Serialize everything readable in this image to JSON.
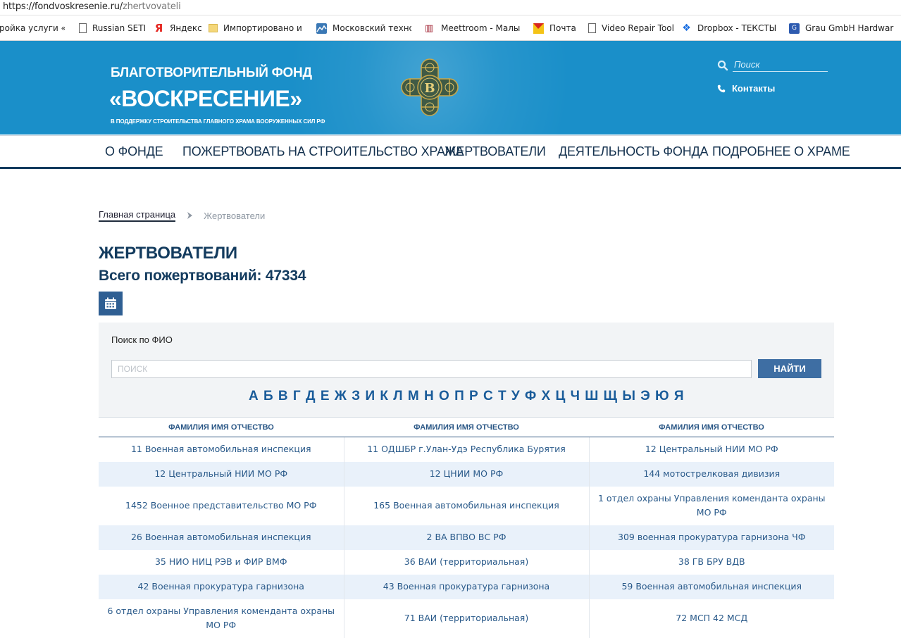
{
  "browser": {
    "url_host": "https://fondvoskresenie.ru/",
    "url_path": "zhertvovateli",
    "bookmarks": [
      {
        "label": "тройка услуги «С",
        "icon": "page-icon"
      },
      {
        "label": "Russian SETI",
        "icon": "page-icon"
      },
      {
        "label": "Яндекс",
        "icon": "yandex-icon"
      },
      {
        "label": "Импортировано из I",
        "icon": "folder-icon"
      },
      {
        "label": "Московский техноло",
        "icon": "mt-icon"
      },
      {
        "label": "Meettroom - Малый",
        "icon": "meettroom-icon"
      },
      {
        "label": "Почта",
        "icon": "mail-icon"
      },
      {
        "label": "Video Repair Tool",
        "icon": "page-icon"
      },
      {
        "label": "Dropbox - ТЕКСТЫ К",
        "icon": "dropbox-icon"
      },
      {
        "label": "Grau GmbH Hardwar",
        "icon": "grau-icon"
      }
    ]
  },
  "header": {
    "brand_line1": "БЛАГОТВОРИТЕЛЬНЫЙ ФОНД",
    "brand_line2": "«ВОСКРЕСЕНИЕ»",
    "brand_line3": "В ПОДДЕРЖКУ СТРОИТЕЛЬСТВА ГЛАВНОГО ХРАМА ВООРУЖЕННЫХ СИЛ РФ",
    "search_placeholder": "Поиск",
    "contacts_label": "Контакты",
    "colors": {
      "header_bg": "#1a8fc9",
      "nav_text": "#14314e",
      "title": "#133b5e",
      "accent": "#3e6ea3"
    }
  },
  "nav": [
    "О ФОНДЕ",
    "ПОЖЕРТВОВАТЬ НА СТРОИТЕЛЬСТВО ХРАМА",
    "ЖЕРТВОВАТЕЛИ",
    "ДЕЯТЕЛЬНОСТЬ ФОНДА",
    "ПОДРОБНЕЕ О ХРАМЕ"
  ],
  "breadcrumb": {
    "home": "Главная страница",
    "current": "Жертвователи"
  },
  "page": {
    "title": "ЖЕРТВОВАТЕЛИ",
    "total_label": "Всего пожертвований: 47334"
  },
  "search": {
    "label": "Поиск по ФИО",
    "placeholder": "ПОИСК",
    "button": "НАЙТИ"
  },
  "alphabet": [
    "А",
    "Б",
    "В",
    "Г",
    "Д",
    "Е",
    "Ж",
    "З",
    "И",
    "К",
    "Л",
    "М",
    "Н",
    "О",
    "П",
    "Р",
    "С",
    "Т",
    "У",
    "Ф",
    "Х",
    "Ц",
    "Ч",
    "Ш",
    "Щ",
    "Ы",
    "Э",
    "Ю",
    "Я"
  ],
  "table": {
    "headers": [
      "ФАМИЛИЯ ИМЯ ОТЧЕСТВО",
      "ФАМИЛИЯ ИМЯ ОТЧЕСТВО",
      "ФАМИЛИЯ ИМЯ ОТЧЕСТВО"
    ],
    "rows": [
      [
        "11 Военная автомобильная инспекция",
        "11 ОДШБР г.Улан-Удэ Республика Бурятия",
        "12 Центральный НИИ МО РФ"
      ],
      [
        "12 Центральный НИИ МО РФ",
        "12 ЦНИИ МО РФ",
        "144 мотострелковая дивизия"
      ],
      [
        "1452 Военное представительство МО РФ",
        "165 Военная автомобильная инспекция",
        "1 отдел охраны Управления коменданта охраны МО РФ"
      ],
      [
        "26 Военная автомобильная инспекция",
        "2 ВА ВПВО ВС РФ",
        "309 военная прокуратура гарнизона ЧФ"
      ],
      [
        "35 НИО НИЦ РЭВ и ФИР ВМФ",
        "36 ВАИ (территориальная)",
        "38 ГВ БРУ ВДВ"
      ],
      [
        "42 Военная прокуратура гарнизона",
        "43 Военная прокуратура гарнизона",
        "59 Военная автомобильная инспекция"
      ],
      [
        "6 отдел охраны Управления коменданта охраны МО РФ",
        "71 ВАИ (территориальная)",
        "72 МСП 42 МСД"
      ]
    ]
  }
}
